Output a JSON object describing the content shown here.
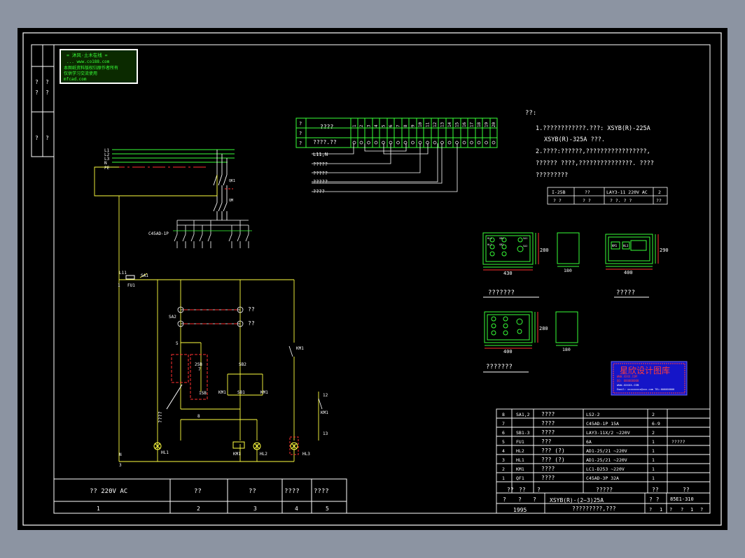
{
  "drawing": {
    "left_strip_cells": [
      "?",
      "?",
      "?",
      "?",
      "?",
      "?"
    ],
    "stamp": {
      "line1": "= 沐风·土木在线 =",
      "line2": "... www.co188.com",
      "line3": "本图纸资料版权归原作者所有",
      "line4": "仅供学习交流使用",
      "line5": "mfcad.com"
    },
    "bus_labels": [
      "L1",
      "L2",
      "L3",
      "N",
      "PE"
    ],
    "breaker_labels": [
      "QK1",
      "QM"
    ],
    "mcb_label": "C45AD-1P",
    "circuit_labels": {
      "l11": "L11",
      "sa1": "SA1",
      "one": "1",
      "fu1": "FU1",
      "sa2": "SA2",
      "lamp1_text": "??",
      "lamp2_text": "??",
      "five": "5",
      "sb_label": "SB",
      "sb2": "SB2",
      "sb_small": "2SB",
      "sb3": "1SB",
      "km_a": "KM1",
      "sb1": "SB1",
      "km_b": "KM1",
      "seven": "7",
      "eight": "8",
      "km1_contact": "KM1",
      "p12": "12",
      "km1_coil_small": "KM1",
      "p13": "13",
      "vert_text": "????",
      "hl1": "HL1",
      "km1": "KM1",
      "hl2": "HL2",
      "hl3": "HL3",
      "n": "N",
      "three": "3"
    },
    "bottom_table": {
      "cells": [
        "?? 220V AC",
        "??",
        "??",
        "????",
        "????"
      ],
      "numbers": [
        "1",
        "2",
        "3",
        "4",
        "5"
      ]
    },
    "terminal": {
      "row_labels": [
        "?",
        "?",
        "?"
      ],
      "title": "????",
      "subtitle": "????.??",
      "numbers": [
        "1",
        "2",
        "3",
        "4",
        "5",
        "6",
        "7",
        "8",
        "9",
        "10",
        "11",
        "12",
        "13",
        "14",
        "15",
        "16",
        "17",
        "18",
        "19",
        "20"
      ],
      "leads": [
        "L11,N",
        "?????",
        "?????",
        "?????",
        "????"
      ]
    },
    "notes": {
      "head": "??:",
      "line1": "1.????????????.???:     XSYB(R)-225A",
      "line2": "XSYB(R)-325A ???.",
      "line3": "2.????:??????,?????????????????,",
      "line4": "?????? ????,???????????????.    ????",
      "line5": "?????????"
    },
    "small_table": {
      "r1": [
        "I-25B",
        "??",
        "LAY3-11  220V  AC",
        "2"
      ],
      "r2": [
        "?  ?",
        "?  ?",
        "?  ?.  ?  ?",
        "??"
      ]
    },
    "box_labels": {
      "box1_dims": [
        "280",
        "430"
      ],
      "box1_side": "180",
      "box1_title": "???????",
      "box2_dims": [
        "290",
        "400"
      ],
      "box2_title": "?????",
      "box3_dims": [
        "280",
        "400"
      ],
      "box3_side": "180",
      "box3_title": "???????",
      "box_btn_labels": [
        "HL1",
        "HL2",
        "SB1",
        "SA2",
        "SB2",
        "SA1",
        "KM1",
        "HL3"
      ]
    },
    "logo": {
      "title": "星欣设计图库",
      "line1": "WWW.XXXX.COM",
      "line2": "QQ: 000000000",
      "line3": "www.xxxxx.com",
      "line4": "Email: xxxxxxxxx@xxx.com   TEL:000000000"
    },
    "parts_table": {
      "rows": [
        [
          "8",
          "SA1,2",
          "????",
          "LS2-2",
          "2",
          ""
        ],
        [
          "7",
          "",
          "????",
          "C45AD-1P    15A",
          "6-9",
          ""
        ],
        [
          "6",
          "SB1-3",
          "????",
          "LAY3-11X/2  ~220V",
          "2",
          ""
        ],
        [
          "5",
          "FU1",
          "???",
          "6A",
          "1",
          "?????"
        ],
        [
          "4",
          "HL2",
          "??? (?)",
          "AD1-25/21  ~220V",
          "1",
          ""
        ],
        [
          "3",
          "HL1",
          "??? (?)",
          "AD1-25/21  ~220V",
          "1",
          ""
        ],
        [
          "2",
          "KM1",
          "????",
          "LC1-D253  ~220V",
          "1",
          ""
        ],
        [
          "1",
          "QF1",
          "????",
          "C45AD-3P    32A",
          "1",
          ""
        ]
      ],
      "header": [
        "??",
        "??",
        "?",
        "?????",
        "??",
        "??"
      ],
      "title_row": [
        "?",
        "?",
        "?",
        "XSYB(R)-(2~3)25A",
        "?  ?",
        "85E1-310"
      ],
      "year": "1995",
      "subtitle": "?????????,???",
      "bottom": [
        "?",
        "1",
        "?",
        "?",
        "1",
        "?"
      ]
    }
  }
}
